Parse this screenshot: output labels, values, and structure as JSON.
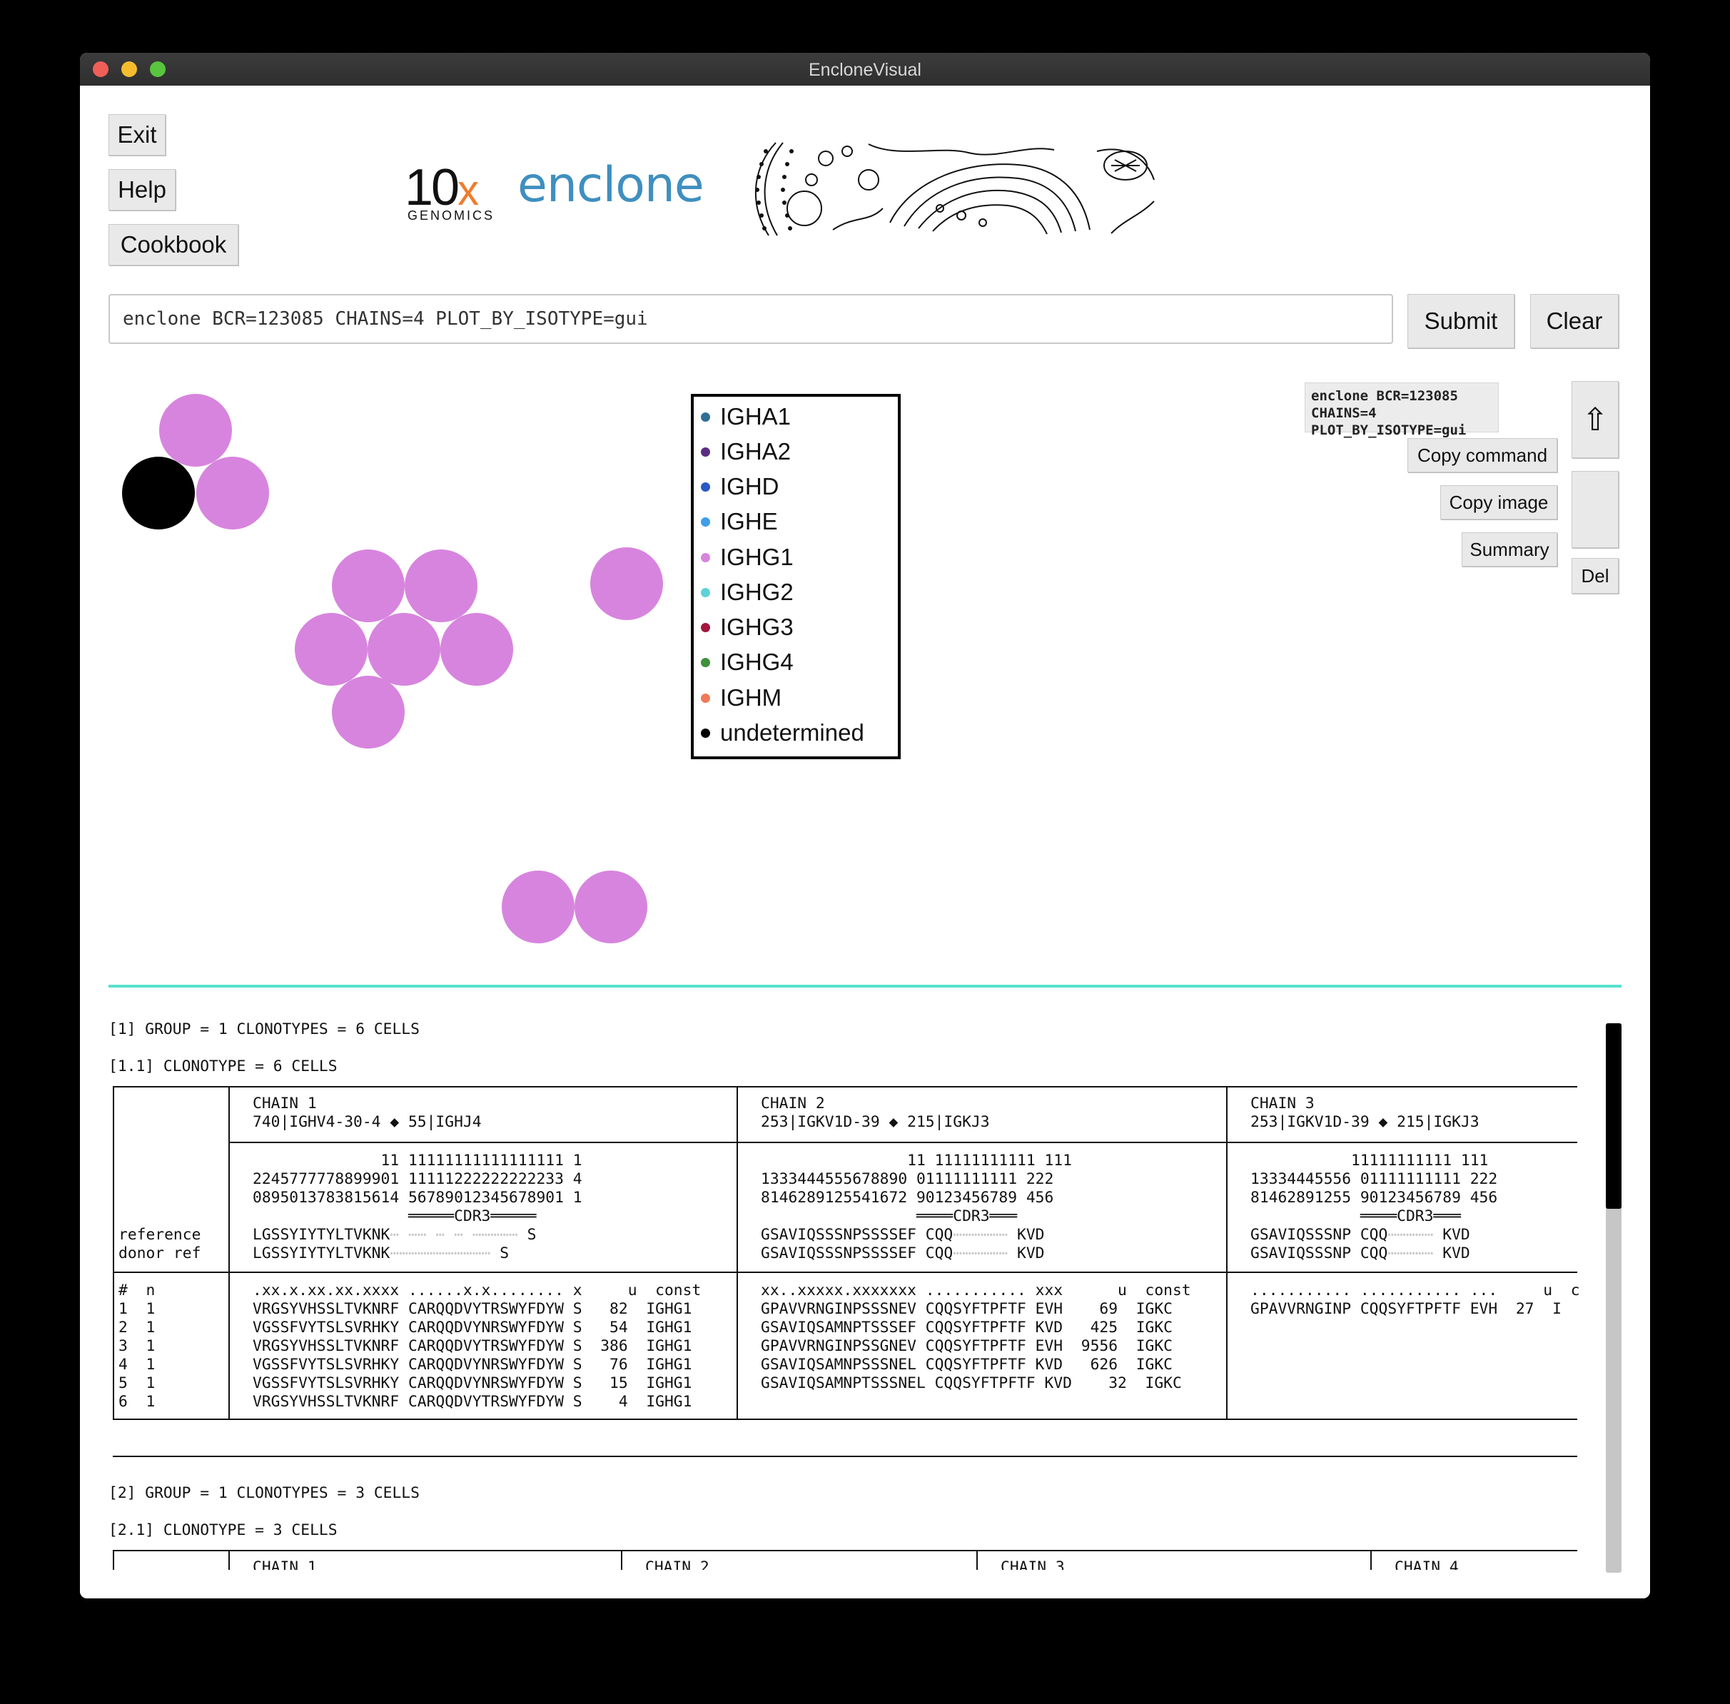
{
  "window": {
    "title": "EncloneVisual"
  },
  "buttons": {
    "exit": "Exit",
    "help": "Help",
    "cookbook": "Cookbook",
    "submit": "Submit",
    "clear": "Clear",
    "copy_command": "Copy command",
    "copy_image": "Copy image",
    "summary": "Summary",
    "del": "Del",
    "up_arrow": "⇧"
  },
  "logos": {
    "tenx_number": "10",
    "tenx_x": "x",
    "tenx_sub": "GENOMICS",
    "enclone": "enclone"
  },
  "command": {
    "value": "enclone BCR=123085 CHAINS=4 PLOT_BY_ISOTYPE=gui",
    "side_line1": "enclone BCR=123085 CHAINS=4",
    "side_line2": "PLOT_BY_ISOTYPE=gui"
  },
  "legend": [
    {
      "label": "IGHA1",
      "color": "#2f6e96"
    },
    {
      "label": "IGHA2",
      "color": "#5b2d82"
    },
    {
      "label": "IGHD",
      "color": "#2a58c4"
    },
    {
      "label": "IGHE",
      "color": "#3e9ee8"
    },
    {
      "label": "IGHG1",
      "color": "#d784de"
    },
    {
      "label": "IGHG2",
      "color": "#5ed2d8"
    },
    {
      "label": "IGHG3",
      "color": "#a3163d"
    },
    {
      "label": "IGHG4",
      "color": "#3f8f3b"
    },
    {
      "label": "IGHM",
      "color": "#f07a5a"
    },
    {
      "label": "undetermined",
      "color": "#000000"
    }
  ],
  "plot": {
    "clusters": [
      {
        "cells": 3,
        "isotypes": [
          "IGHG1",
          "undetermined",
          "IGHG1"
        ]
      },
      {
        "cells": 6,
        "isotypes": [
          "IGHG1",
          "IGHG1",
          "IGHG1",
          "IGHG1",
          "IGHG1",
          "IGHG1"
        ]
      },
      {
        "cells": 1,
        "isotypes": [
          "IGHG1"
        ]
      },
      {
        "cells": 2,
        "isotypes": [
          "IGHG1",
          "IGHG1"
        ]
      }
    ]
  },
  "results": {
    "group1_header": "[1] GROUP = 1 CLONOTYPES = 6 CELLS",
    "clonotype1_header": "[1.1] CLONOTYPE = 6 CELLS",
    "chain1_title": "CHAIN 1",
    "chain1_genes": "740|IGHV4-30-4 ◆ 55|IGHJ4",
    "chain2_title": "CHAIN 2",
    "chain2_genes": "253|IGKV1D-39 ◆ 215|IGKJ3",
    "chain3_title": "CHAIN 3",
    "chain3_genes": "253|IGKV1D-39 ◆ 215|IGKJ3",
    "pos_c1_l1": "              11 11111111111111111 1",
    "pos_c1_l2": "2245777778899901 11111222222222233 4",
    "pos_c1_l3": "0895013783815614 56789012345678901 1",
    "pos_c1_cdr": "                 ═════CDR3═════",
    "pos_c2_l1": "                11 11111111111 111",
    "pos_c2_l2": "1333444555678890 01111111111 222",
    "pos_c2_l3": "8146289125541672 90123456789 456",
    "pos_c2_cdr": "                 ════CDR3═══",
    "pos_c3_l1": "           11111111111 111",
    "pos_c3_l2": "13334445556 01111111111 222",
    "pos_c3_l3": "81462891255 90123456789 456",
    "pos_c3_cdr": "            ════CDR3═══",
    "reference_label": "reference",
    "donor_label": "donor ref",
    "ref_c1": "LGSSYIYTYLTVKNK",
    "ref_c1_dots": "⋯ ⋯⋯ ⋯ ⋯ ⋯⋯⋯⋯⋯ ",
    "ref_c1_end": "S",
    "donor_c1": "LGSSYIYTYLTVKNK",
    "donor_c1_dots": "⋯⋯⋯⋯⋯⋯⋯⋯⋯⋯⋯ ",
    "donor_c1_end": "S",
    "ref_c2": "GSAVIQSSSNPSSSSEF CQQ",
    "ref_c2_dots": "⋯⋯⋯⋯⋯⋯ ",
    "ref_c2_end": "KVD",
    "donor_c2": "GSAVIQSSSNPSSSSEF CQQ",
    "donor_c2_dots": "⋯⋯⋯⋯⋯⋯ ",
    "donor_c2_end": "KVD",
    "ref_c3": "GSAVIQSSSNP CQQ",
    "ref_c3_dots": "⋯⋯⋯⋯⋯ ",
    "ref_c3_end": "KVD",
    "donor_c3": "GSAVIQSSSNP CQQ",
    "donor_c3_dots": "⋯⋯⋯⋯⋯ ",
    "donor_c3_end": "KVD",
    "col_hdr_idx": "#  n",
    "col_hdr_c1": ".xx.x.xx.xx.xxxx ......x.x........ x     u  const",
    "col_hdr_c2": "xx..xxxxx.xxxxxxx ........... xxx      u  const",
    "col_hdr_c3": "........... ........... ...     u  c",
    "rows": [
      {
        "idx": "1  1",
        "c1": "VRGSYVHSSLTVKNRF CARQQDVYTRSWYFDYW S   82  IGHG1",
        "c2": "GPAVVRNGINPSSSNEV CQQSYFTPFTF EVH    69  IGKC",
        "c3": "GPAVVRNGINP CQQSYFTPFTF EVH  27  I"
      },
      {
        "idx": "2  1",
        "c1": "VGSSFVYTSLSVRHKY CARQQDVYNRSWYFDYW S   54  IGHG1",
        "c2": "GSAVIQSAMNPTSSSEF CQQSYFTPFTF KVD   425  IGKC",
        "c3": ""
      },
      {
        "idx": "3  1",
        "c1": "VRGSYVHSSLTVKNRF CARQQDVYTRSWYFDYW S  386  IGHG1",
        "c2": "GPAVVRNGINPSSGNEV CQQSYFTPFTF EVH  9556  IGKC",
        "c3": ""
      },
      {
        "idx": "4  1",
        "c1": "VGSSFVYTSLSVRHKY CARQQDVYNRSWYFDYW S   76  IGHG1",
        "c2": "GSAVIQSAMNPSSSNEL CQQSYFTPFTF KVD   626  IGKC",
        "c3": ""
      },
      {
        "idx": "5  1",
        "c1": "VGSSFVYTSLSVRHKY CARQQDVYNRSWYFDYW S   15  IGHG1",
        "c2": "GSAVIQSAMNPTSSSNEL CQQSYFTPFTF KVD    32  IGKC",
        "c3": ""
      },
      {
        "idx": "6  1",
        "c1": "VRGSYVHSSLTVKNRF CARQQDVYTRSWYFDYW S    4  IGHG1",
        "c2": "",
        "c3": ""
      }
    ],
    "group2_header": "[2] GROUP = 1 CLONOTYPES = 3 CELLS",
    "clonotype2_header": "[2.1] CLONOTYPE = 3 CELLS",
    "g2_chain1": "CHAIN 1",
    "g2_chain2": "CHAIN 2",
    "g2_chain3": "CHAIN 3",
    "g2_chain4": "CHAIN 4"
  }
}
